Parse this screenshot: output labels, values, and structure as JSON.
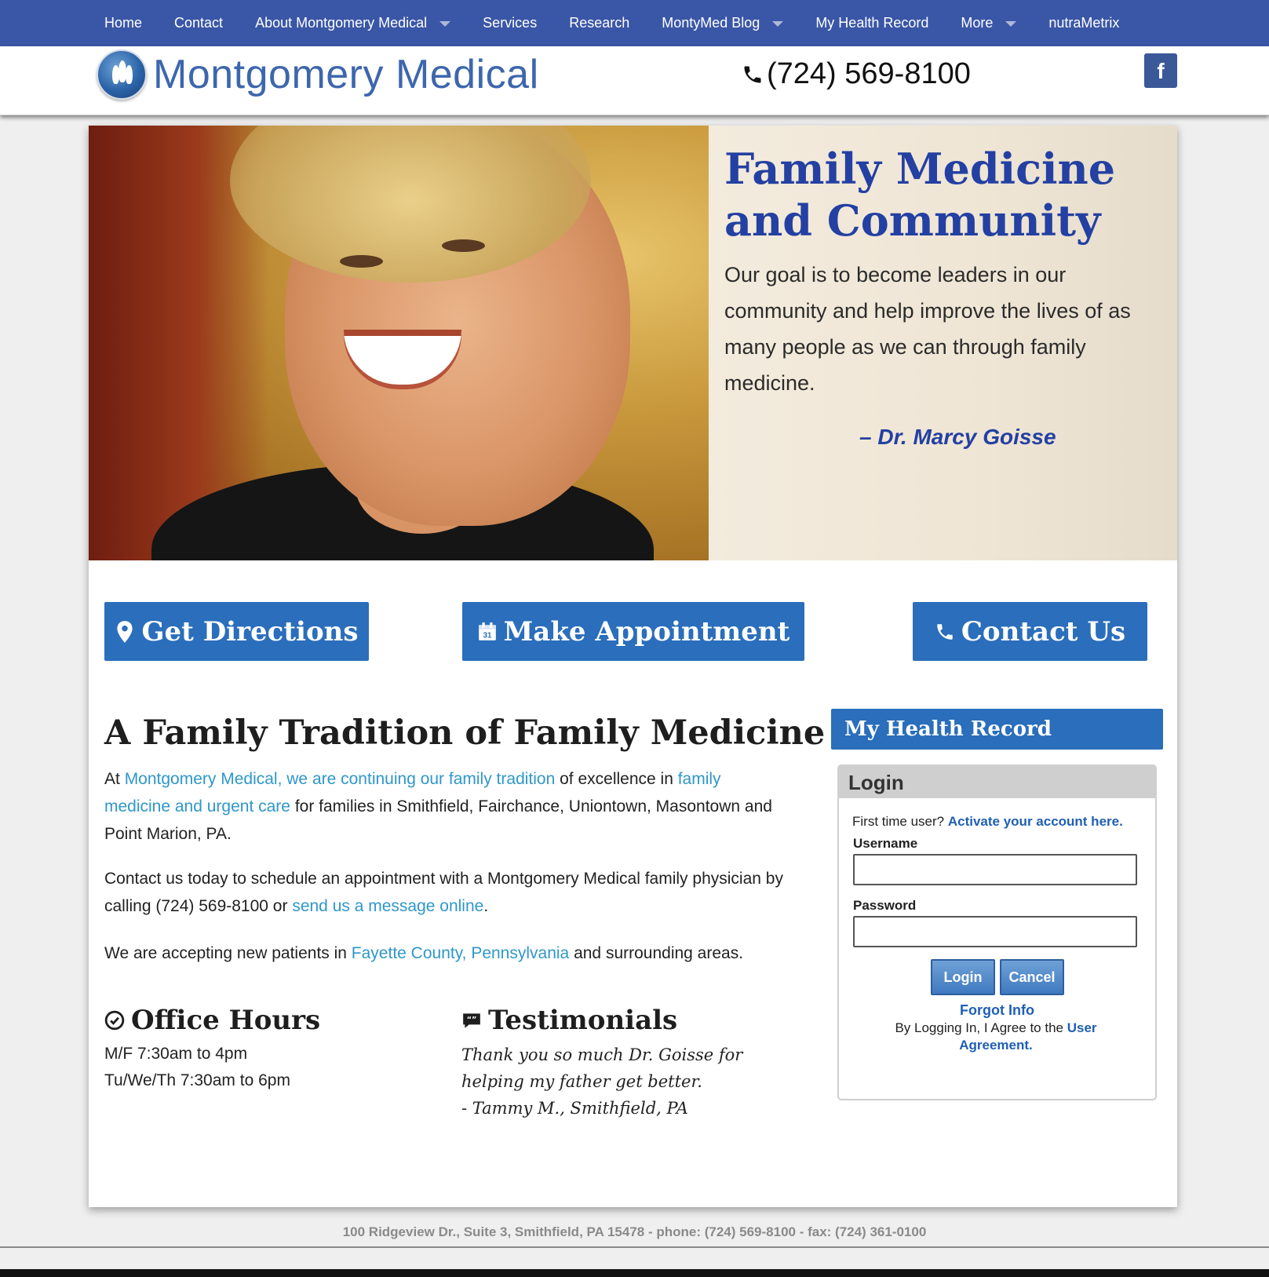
{
  "nav": {
    "items": [
      {
        "label": "Home"
      },
      {
        "label": "Contact"
      },
      {
        "label": "About Montgomery Medical"
      },
      {
        "label": "Services"
      },
      {
        "label": "Research"
      },
      {
        "label": "MontyMed Blog"
      },
      {
        "label": "My Health Record"
      },
      {
        "label": "More"
      },
      {
        "label": "nutraMetrix"
      }
    ]
  },
  "header": {
    "logo_text": "Montgomery Medical",
    "phone": "(724) 569-8100",
    "facebook_glyph": "f"
  },
  "hero": {
    "title": "Family Medicine and Community",
    "quote": "Our goal is to become leaders in our community and help improve the lives of as many people as we can through family medicine.",
    "author": "– Dr. Marcy Goisse"
  },
  "cta": {
    "directions": "Get Directions",
    "appointment": "Make Appointment",
    "contact": "Contact Us"
  },
  "main": {
    "title": "A Family Tradition of Family Medicine",
    "p1": {
      "t1": "At ",
      "link1": "Montgomery Medical, we are continuing our family tradition",
      "t2": " of excellence in ",
      "link2": "family medicine and urgent care",
      "t3": " for families in Smithfield, Fairchance, Uniontown, Masontown and Point Marion, PA."
    },
    "p2": {
      "t1": "Contact us today to schedule an appointment with a Montgomery Medical family physician by calling (724) 569-8100 or ",
      "link1": "send us a message online",
      "t2": "."
    },
    "p3": {
      "t1": "We are accepting new patients in ",
      "link1": "Fayette County, Pennsylvania",
      "t2": " and surrounding areas."
    }
  },
  "office_hours": {
    "title": "Office Hours",
    "lines": [
      "M/F 7:30am to 4pm",
      "Tu/We/Th 7:30am to 6pm"
    ]
  },
  "testimonials": {
    "title": "Testimonials",
    "lines": [
      "Thank you so much Dr. Goisse for",
      "helping my father get better.",
      "- Tammy M., Smithfield, PA"
    ]
  },
  "health_record": {
    "header": "My Health Record",
    "login_title": "Login",
    "first_time": "First time user? ",
    "activate_link": "Activate your account here.",
    "username_label": "Username",
    "password_label": "Password",
    "username_value": "",
    "password_value": "",
    "login_button": "Login",
    "cancel_button": "Cancel",
    "forgot": "Forgot Info",
    "agree_text": "By Logging In, I Agree to the ",
    "agree_link": "User Agreement."
  },
  "footer": {
    "text": "100 Ridgeview Dr., Suite 3, Smithfield, PA 15478 - phone: (724) 569-8100 - fax: (724) 361-0100"
  },
  "colors": {
    "nav_bg": "#3a56a6",
    "accent_blue": "#2a6ebc",
    "link": "#2f97c9",
    "hero_title": "#2340a2",
    "facebook": "#3b5898"
  }
}
